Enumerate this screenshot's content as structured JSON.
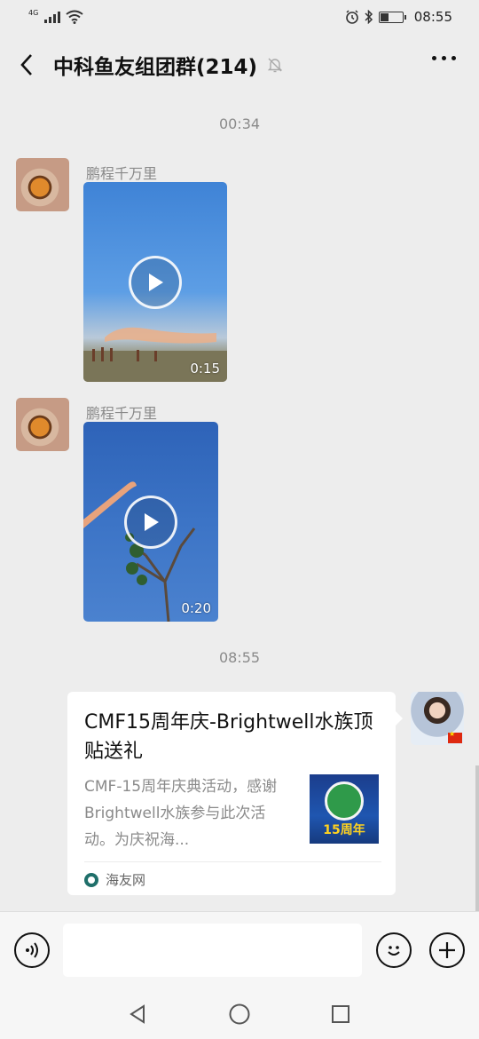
{
  "status_bar": {
    "network": "4G",
    "time": "08:55"
  },
  "nav": {
    "title": "中科鱼友组团群(214)"
  },
  "messages": {
    "timestamp_1": "00:34",
    "video_1": {
      "sender": "鹏程千万里",
      "duration": "0:15"
    },
    "video_2": {
      "sender": "鹏程千万里",
      "duration": "0:20"
    },
    "timestamp_2": "08:55",
    "link_card": {
      "title": "CMF15周年庆-Brightwell水族顶贴送礼",
      "description": "CMF-15周年庆典活动，感谢Brightwell水族参与此次活动。为庆祝海...",
      "thumb_text": "15周年",
      "source": "海友网"
    }
  },
  "input": {
    "placeholder": ""
  },
  "icons": {
    "back": "back-arrow-icon",
    "mute": "bell-off-icon",
    "more": "more-dots-icon",
    "voice": "voice-icon",
    "emoji": "emoji-icon",
    "plus": "plus-icon",
    "nav_back": "triangle-back-icon",
    "nav_home": "circle-home-icon",
    "nav_recent": "square-recent-icon"
  },
  "colors": {
    "background": "#ededed",
    "card": "#ffffff",
    "meta_text": "#8a8a8a"
  }
}
